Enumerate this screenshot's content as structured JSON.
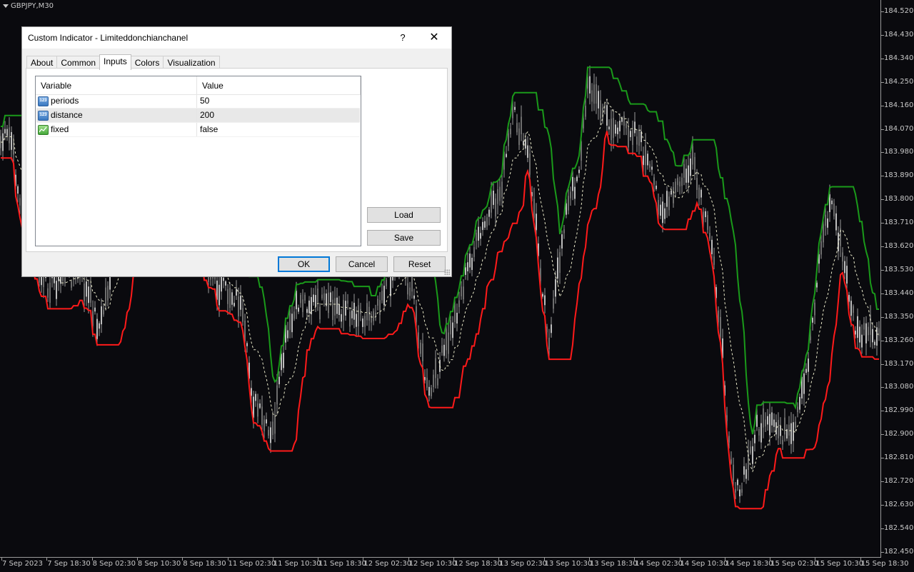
{
  "chart": {
    "symbol": "GBPJPY,M30",
    "colors": {
      "background": "#0a0a0e",
      "upper_channel": "#1a9a1a",
      "lower_channel": "#ff1a1a",
      "middle_line": "#e8e8c8",
      "candles": "#9a9a9a"
    },
    "price_labels": [
      "184.520",
      "184.430",
      "184.340",
      "184.250",
      "184.160",
      "184.070",
      "183.980",
      "183.890",
      "183.800",
      "183.710",
      "183.620",
      "183.530",
      "183.440",
      "183.350",
      "183.260",
      "183.170",
      "183.080",
      "182.990",
      "182.900",
      "182.810",
      "182.720",
      "182.630",
      "182.540",
      "182.450"
    ],
    "time_labels": [
      "7 Sep 2023",
      "7 Sep 18:30",
      "8 Sep 02:30",
      "8 Sep 10:30",
      "8 Sep 18:30",
      "11 Sep 02:30",
      "11 Sep 10:30",
      "11 Sep 18:30",
      "12 Sep 02:30",
      "12 Sep 10:30",
      "12 Sep 18:30",
      "13 Sep 02:30",
      "13 Sep 10:30",
      "13 Sep 18:30",
      "14 Sep 02:30",
      "14 Sep 10:30",
      "14 Sep 18:30",
      "15 Sep 02:30",
      "15 Sep 10:30",
      "15 Sep 18:30"
    ]
  },
  "dialog": {
    "title": "Custom Indicator - Limiteddonchianchanel",
    "help": "?",
    "close": "✕",
    "tabs": [
      "About",
      "Common",
      "Inputs",
      "Colors",
      "Visualization"
    ],
    "active_tab": "Inputs",
    "grid": {
      "headers": {
        "variable": "Variable",
        "value": "Value"
      },
      "rows": [
        {
          "icon": "123",
          "type": "number-icon",
          "variable": "periods",
          "value": "50"
        },
        {
          "icon": "",
          "type": "bool-icon",
          "variable": "distance",
          "value": "200"
        },
        {
          "icon": "",
          "type": "bool-icon",
          "variable": "fixed",
          "value": "false"
        }
      ]
    },
    "buttons": {
      "load": "Load",
      "save": "Save",
      "ok": "OK",
      "cancel": "Cancel",
      "reset": "Reset"
    }
  }
}
